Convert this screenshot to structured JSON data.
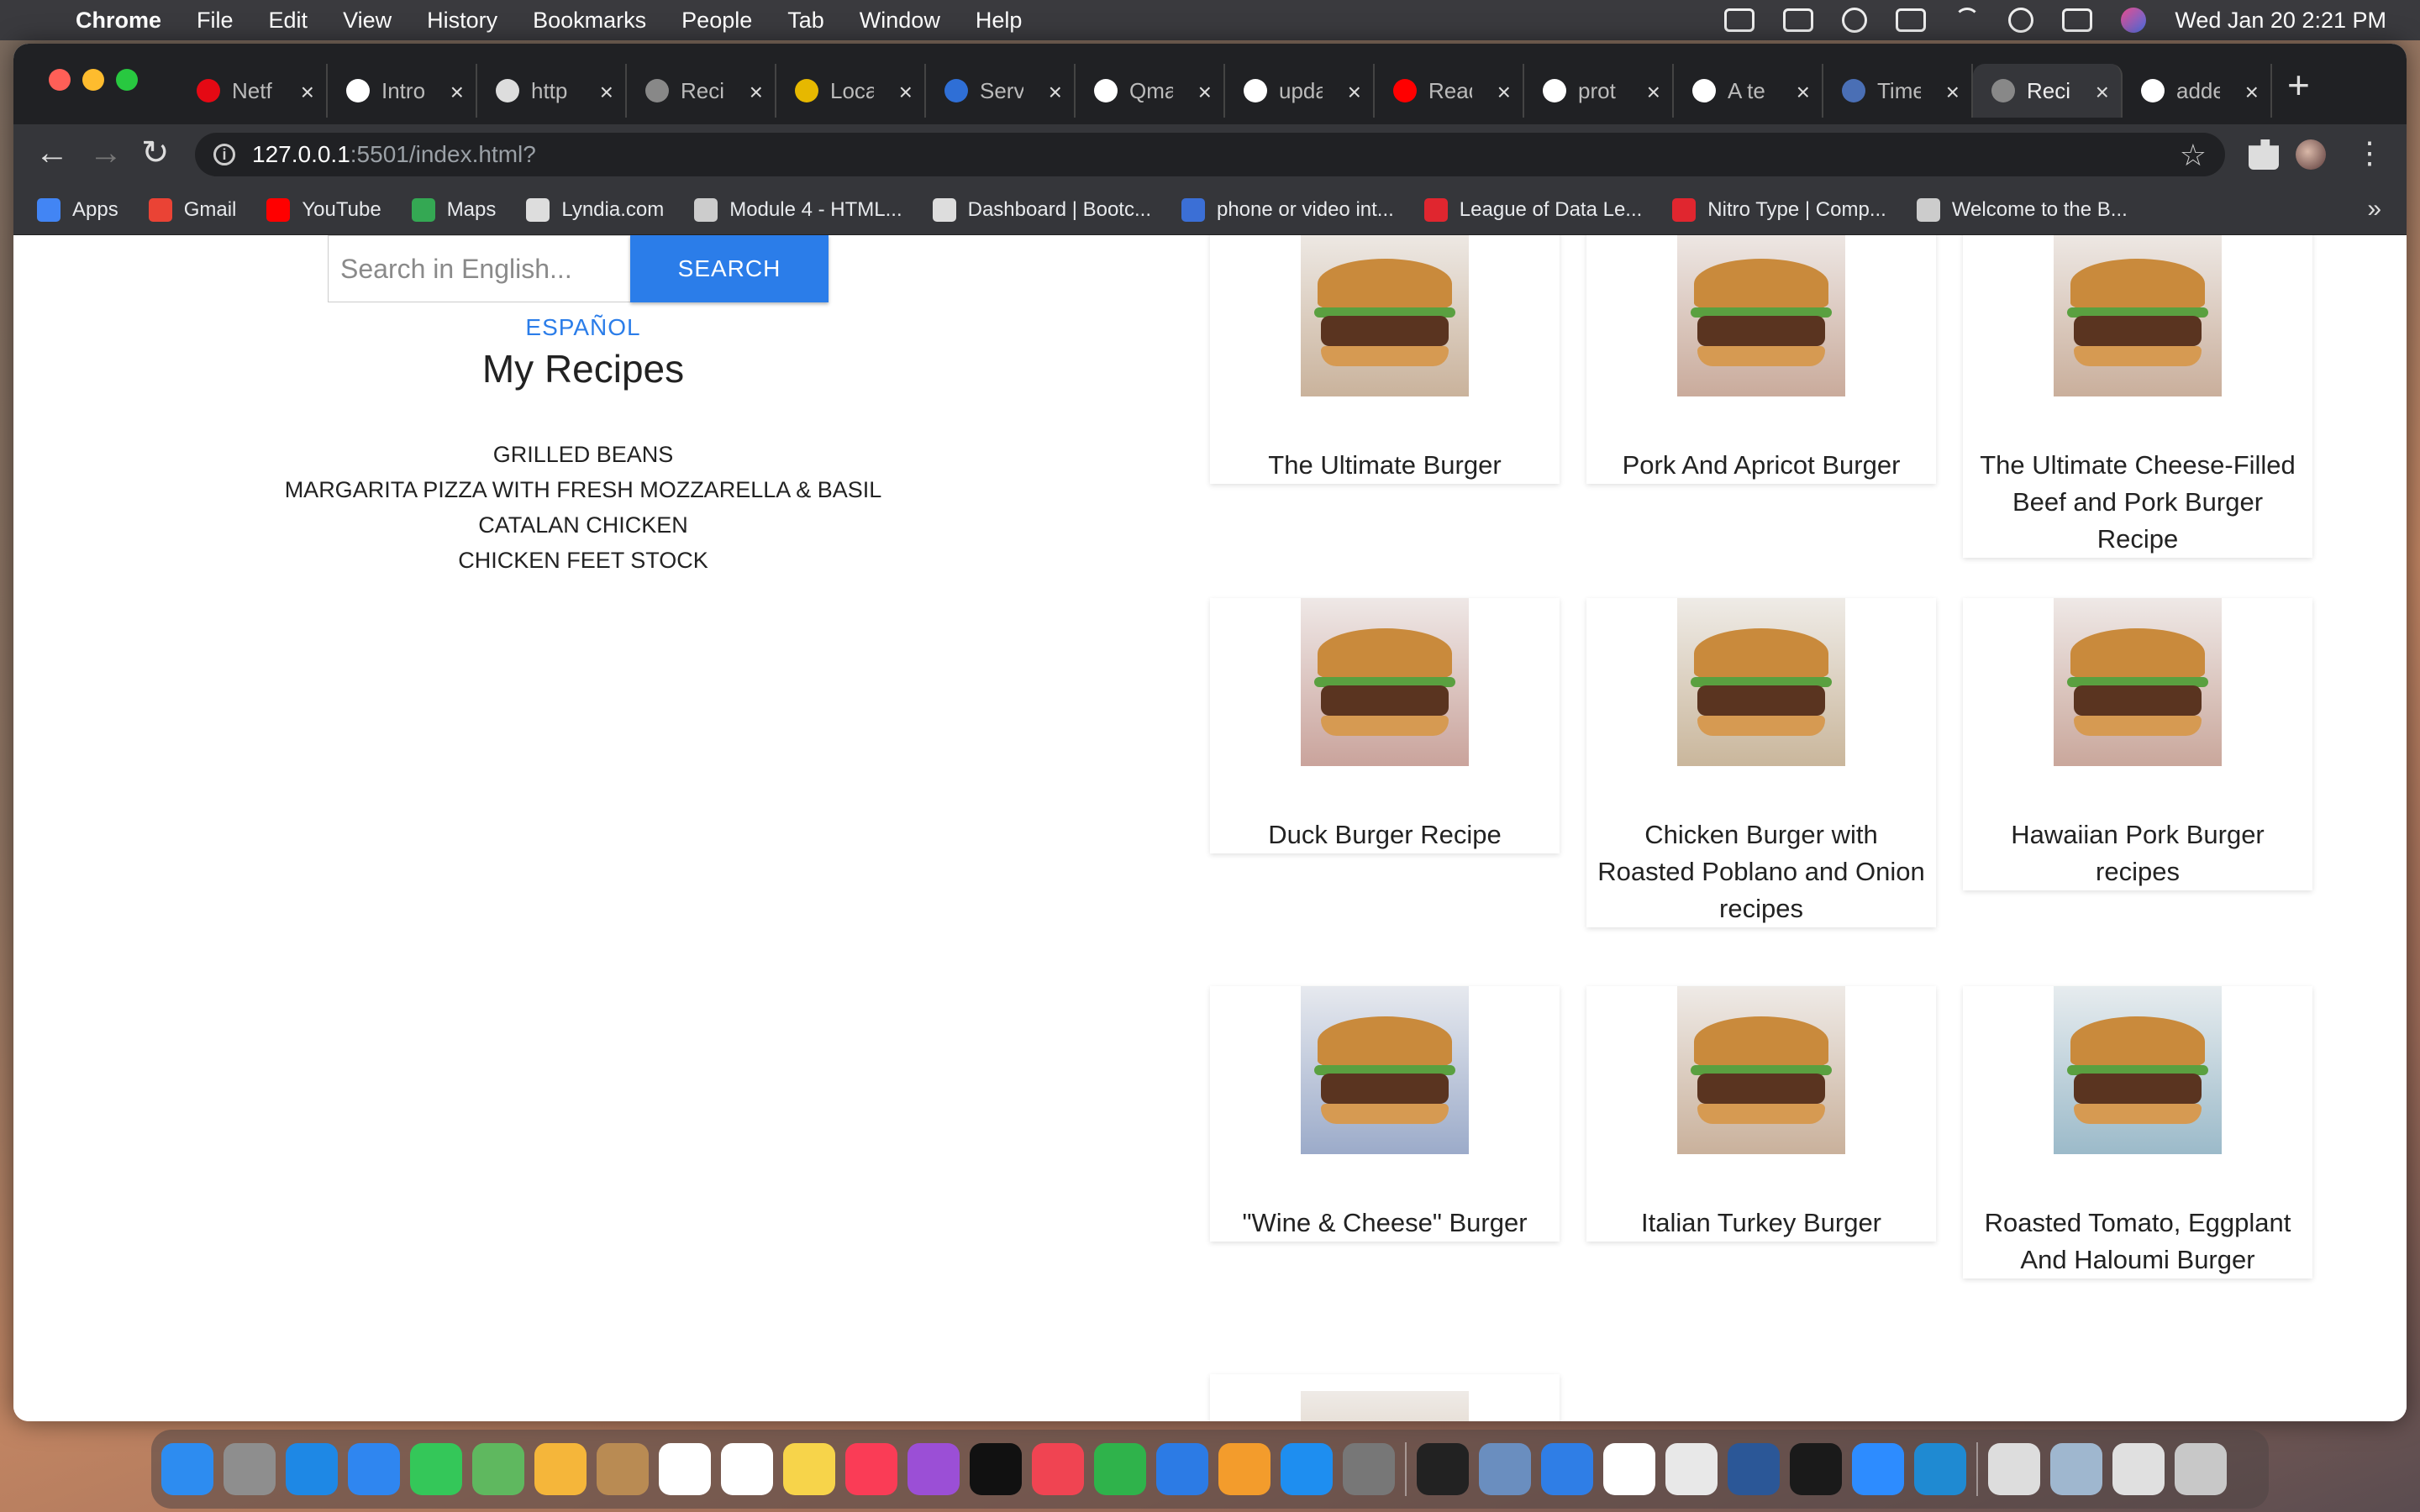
{
  "menubar": {
    "app": "Chrome",
    "items": [
      "File",
      "Edit",
      "View",
      "History",
      "Bookmarks",
      "People",
      "Tab",
      "Window",
      "Help"
    ],
    "datetime": "Wed Jan 20  2:21 PM"
  },
  "tabs": [
    {
      "label": "Netf",
      "icon": "netflix-icon",
      "color": "#e50914"
    },
    {
      "label": "Intro",
      "icon": "cs-icon",
      "color": "#ffffff"
    },
    {
      "label": "http",
      "icon": "soccer-icon",
      "color": "#dddddd"
    },
    {
      "label": "Reci",
      "icon": "globe-icon",
      "color": "#888888"
    },
    {
      "label": "Loca",
      "icon": "location-icon",
      "color": "#e6b800"
    },
    {
      "label": "Serv",
      "icon": "h-icon",
      "color": "#2f6fd6"
    },
    {
      "label": "Qma",
      "icon": "q-icon",
      "color": "#ffffff"
    },
    {
      "label": "upda",
      "icon": "github-icon",
      "color": "#ffffff"
    },
    {
      "label": "Read",
      "icon": "youtube-icon",
      "color": "#ff0000"
    },
    {
      "label": "prot",
      "icon": "github-icon",
      "color": "#ffffff"
    },
    {
      "label": "A te",
      "icon": "github-icon",
      "color": "#ffffff"
    },
    {
      "label": "Time",
      "icon": "clock-icon",
      "color": "#4a6fb5"
    },
    {
      "label": "Reci",
      "icon": "globe-icon",
      "color": "#888888",
      "active": true
    },
    {
      "label": "adde",
      "icon": "github-icon",
      "color": "#ffffff"
    }
  ],
  "address": {
    "host": "127.0.0.1",
    "path": ":5501/index.html?"
  },
  "bookmarks": [
    {
      "label": "Apps",
      "icon": "apps-grid-icon",
      "color": "#4285f4"
    },
    {
      "label": "Gmail",
      "icon": "gmail-icon",
      "color": "#ea4335"
    },
    {
      "label": "YouTube",
      "icon": "youtube-icon",
      "color": "#ff0000"
    },
    {
      "label": "Maps",
      "icon": "maps-icon",
      "color": "#34a853"
    },
    {
      "label": "Lyndia.com",
      "icon": "globe-icon",
      "color": "#dddddd"
    },
    {
      "label": "Module 4 - HTML...",
      "icon": "book-icon",
      "color": "#cccccc"
    },
    {
      "label": "Dashboard | Bootc...",
      "icon": "globe-icon",
      "color": "#dddddd"
    },
    {
      "label": "phone or video int...",
      "icon": "interview-icon",
      "color": "#3b6fd6"
    },
    {
      "label": "League of Data Le...",
      "icon": "m-icon",
      "color": "#e0262f"
    },
    {
      "label": "Nitro Type | Comp...",
      "icon": "n-icon",
      "color": "#e0262f"
    },
    {
      "label": "Welcome to the B...",
      "icon": "book-icon",
      "color": "#cccccc"
    }
  ],
  "page": {
    "search_placeholder": "Search in English...",
    "search_button": "SEARCH",
    "language_link": "ESPAÑOL",
    "my_recipes_title": "My Recipes",
    "saved_recipes": [
      "GRILLED BEANS",
      "MARGARITA PIZZA WITH FRESH MOZZARELLA & BASIL",
      "CATALAN CHICKEN",
      "CHICKEN FEET STOCK"
    ],
    "results": [
      {
        "title": "The Ultimate Burger"
      },
      {
        "title": "Pork And Apricot Burger"
      },
      {
        "title": "The Ultimate Cheese-Filled Beef and Pork Burger Recipe"
      },
      {
        "title": "Duck Burger Recipe"
      },
      {
        "title": "Chicken Burger with Roasted Poblano and Onion recipes"
      },
      {
        "title": "Hawaiian Pork Burger recipes"
      },
      {
        "title": "\"Wine & Cheese\" Burger"
      },
      {
        "title": "Italian Turkey Burger"
      },
      {
        "title": "Roasted Tomato, Eggplant And Haloumi Burger"
      },
      {
        "title": ""
      }
    ]
  },
  "colors": {
    "accent": "#2b7de9",
    "chrome_dark": "#202124",
    "chrome_toolbar": "#35363a"
  }
}
